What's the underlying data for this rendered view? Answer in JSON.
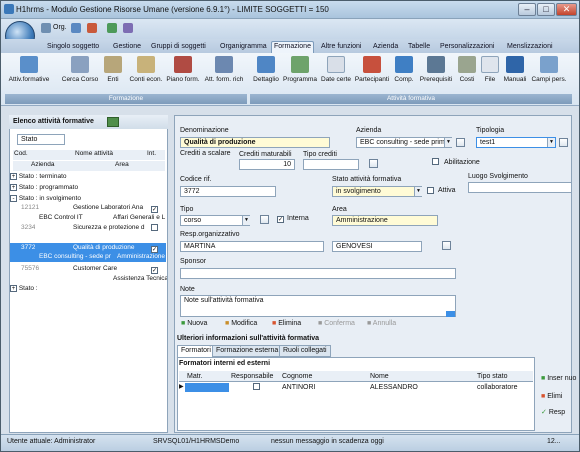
{
  "window": {
    "title": "H1hrms - Modulo Gestione Risorse Umane (versione 6.9.1°) - LIMITE SOGGETTI = 150",
    "min": "–",
    "max": "□",
    "close": "✕"
  },
  "qat": {
    "label": "Org."
  },
  "tabs": [
    "Singolo soggetto",
    "Gestione",
    "Gruppi di soggetti",
    "Organigramma",
    "Formazione",
    "Altre funzioni",
    "Azienda",
    "Tabelle",
    "Personalizzazioni",
    "Menslizzazioni"
  ],
  "ribbon": {
    "group1": {
      "label": "Formazione",
      "buttons": [
        "Attiv.formative",
        "Cerca Corso",
        "Enti",
        "Conti econ.",
        "Piano form.",
        "Att. form. rich"
      ]
    },
    "group2": {
      "label": "Attività formativa",
      "buttons": [
        "Dettaglio",
        "Programma",
        "Date certe",
        "Partecipanti",
        "Comp.",
        "Prerequisiti",
        "Costi",
        "File",
        "Manuali",
        "Campi pers."
      ]
    }
  },
  "left": {
    "title": "Elenco attività formative",
    "group_select": "Stato",
    "cols1": [
      "Cod.",
      "Nome attività",
      "Int."
    ],
    "cols2": [
      "Azienda",
      "Area"
    ],
    "groups": [
      "Stato : terminato",
      "Stato : programmato",
      "Stato : in svolgimento",
      "Stato :"
    ],
    "rows": [
      {
        "cod": "12121",
        "nome": "Gestione Laboratori Ana",
        "azienda": "EBC Control IT",
        "area": "Affari Generali e L"
      },
      {
        "cod": "3234",
        "nome": "Sicurezza e protezione d",
        "azienda": "",
        "area": ""
      },
      {
        "cod": "3772",
        "nome": "Qualità di produzione",
        "azienda": "EBC consulting - sede pr",
        "area": "Amministrazione"
      },
      {
        "cod": "75576",
        "nome": "Customer Care",
        "azienda": "",
        "area": "Assistenza Tecnica"
      }
    ]
  },
  "form": {
    "denominazione_label": "Denominazione",
    "denominazione": "Qualità di produzione",
    "azienda_label": "Azienda",
    "azienda": "EBC consulting - sede primaria",
    "tipologia_label": "Tipologia",
    "tipologia": "test1",
    "crediti_label": "Crediti a scalare",
    "maturabili_label": "Crediti maturabili",
    "maturabili": "10",
    "tipo_crediti_label": "Tipo crediti",
    "abilitazione_label": "Abilitazione",
    "codice_label": "Codice rif.",
    "codice": "3772",
    "stato_label": "Stato attività formativa",
    "stato": "in svolgimento",
    "attiva_label": "Attiva",
    "luogo_label": "Luogo Svolgimento",
    "tipo_label": "Tipo",
    "tipo": "corso",
    "interna_label": "Interna",
    "area_label": "Area",
    "area": "Amministrazione",
    "resp_label": "Resp.organizzativo",
    "resp_nome": "MARTINA",
    "resp_cognome": "GENOVESI",
    "sponsor_label": "Sponsor",
    "note_label": "Note",
    "note": "Note sull'attività formativa"
  },
  "actions": [
    "Nuova",
    "Modifica",
    "Elimina",
    "Conferma",
    "Annulla"
  ],
  "extra": {
    "title": "Ulteriori informazioni sull'attività formativa",
    "tabs": [
      "Formatori",
      "Formazione esterna",
      "Ruoli collegati"
    ],
    "subtitle": "Formatori interni ed esterni",
    "cols": [
      "Matr.",
      "Responsabile",
      "Cognome",
      "Nome",
      "Tipo stato"
    ],
    "row": {
      "cognome": "ANTINORI",
      "nome": "ALESSANDRO",
      "tipo": "collaboratore"
    },
    "side_buttons": [
      "Inser nuo",
      "Elimi",
      "Resp"
    ]
  },
  "status": {
    "user": "Utente attuale: Administrator",
    "server": "SRVSQL01/H1HRMSDemo",
    "msg": "nessun messaggio in scadenza oggi",
    "right": "12..."
  }
}
